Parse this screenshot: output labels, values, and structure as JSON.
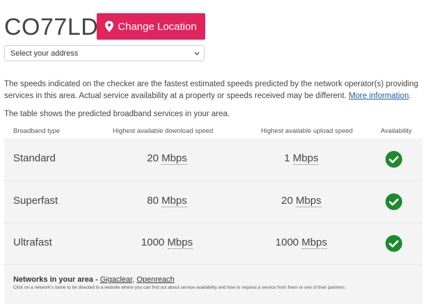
{
  "header": {
    "postcode": "CO77LD",
    "change_location_label": "Change Location"
  },
  "address_select": {
    "selected": "Select your address"
  },
  "disclaimer": {
    "text": "The speeds indicated on the checker are the fastest estimated speeds predicted by the network operator(s) providing services in this area. Actual service availability at a property or speeds received may be different.",
    "link": "More information",
    "suffix": "."
  },
  "intro": "The table shows the predicted broadband services in your area.",
  "table": {
    "headers": {
      "type": "Broadband type",
      "download": "Highest available download speed",
      "upload": "Highest available upload speed",
      "availability": "Availability"
    },
    "rows": [
      {
        "type": "Standard",
        "download": "20",
        "upload": "1",
        "unit": "Mbps",
        "available": true
      },
      {
        "type": "Superfast",
        "download": "80",
        "upload": "20",
        "unit": "Mbps",
        "available": true
      },
      {
        "type": "Ultrafast",
        "download": "1000",
        "upload": "1000",
        "unit": "Mbps",
        "available": true
      }
    ]
  },
  "networks": {
    "label": "Networks in your area",
    "separator": " - ",
    "items": [
      "Gigaclear",
      "Openreach"
    ],
    "note": "Click on a network's name to be directed to a website where you can find out about service availability and how to request a service from them or one of their partners."
  },
  "colors": {
    "accent": "#e0245e",
    "check": "#1e8a2e",
    "link": "#1a5ea6"
  }
}
